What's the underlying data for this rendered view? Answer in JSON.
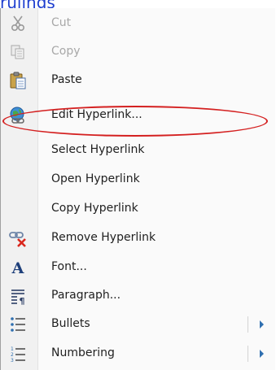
{
  "document": {
    "visible_text": "rulings"
  },
  "menu": {
    "items": [
      {
        "id": "cut",
        "label": "Cut",
        "icon": "scissors-icon",
        "disabled": true
      },
      {
        "id": "copy",
        "label": "Copy",
        "icon": "copy-icon",
        "disabled": true
      },
      {
        "id": "paste",
        "label": "Paste",
        "icon": "paste-icon",
        "disabled": false
      },
      {
        "id": "edit-hyperlink",
        "label": "Edit Hyperlink...",
        "icon": "globe-link-icon",
        "disabled": false,
        "highlighted": true
      },
      {
        "id": "select-hyperlink",
        "label": "Select Hyperlink",
        "icon": "",
        "disabled": false
      },
      {
        "id": "open-hyperlink",
        "label": "Open Hyperlink",
        "icon": "",
        "disabled": false
      },
      {
        "id": "copy-hyperlink",
        "label": "Copy Hyperlink",
        "icon": "",
        "disabled": false
      },
      {
        "id": "remove-hyperlink",
        "label": "Remove Hyperlink",
        "icon": "remove-link-icon",
        "disabled": false
      },
      {
        "id": "font",
        "label": "Font...",
        "icon": "font-icon",
        "disabled": false
      },
      {
        "id": "paragraph",
        "label": "Paragraph...",
        "icon": "paragraph-icon",
        "disabled": false
      },
      {
        "id": "bullets",
        "label": "Bullets",
        "icon": "bullets-icon",
        "disabled": false,
        "submenu": true
      },
      {
        "id": "numbering",
        "label": "Numbering",
        "icon": "numbering-icon",
        "disabled": false,
        "submenu": true
      }
    ]
  },
  "colors": {
    "hyperlink": "#1f3fcf",
    "highlight_ring": "#d42020",
    "disabled_text": "#a8a8a8",
    "submenu_arrow": "#2f6fb0"
  }
}
